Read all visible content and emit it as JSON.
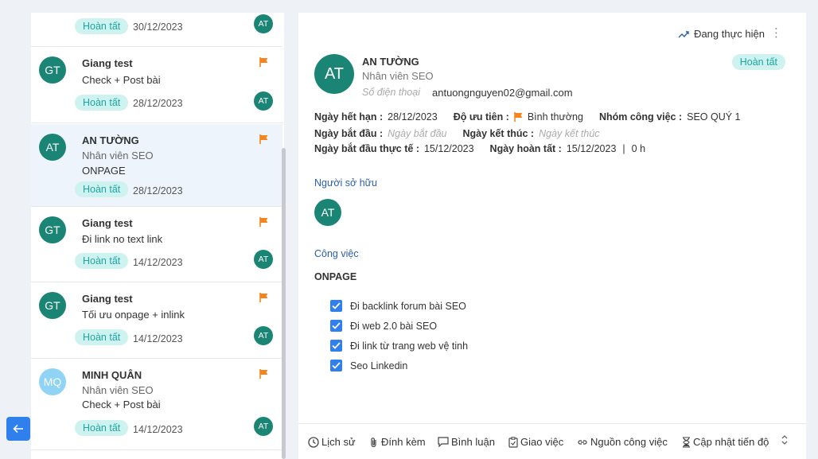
{
  "list": {
    "items": [
      {
        "avatar": "",
        "title": "",
        "lines": [],
        "badge": "Hoàn tất",
        "date": "30/12/2023",
        "assignee": "AT"
      },
      {
        "avatar": "GT",
        "title": "Giang test",
        "lines": [
          "Check + Post bài"
        ],
        "badge": "Hoàn tất",
        "date": "28/12/2023",
        "assignee": "AT"
      },
      {
        "avatar": "AT",
        "title": "AN TƯỜNG",
        "lines": [
          "Nhân viên SEO",
          "ONPAGE"
        ],
        "badge": "Hoàn tất",
        "date": "28/12/2023",
        "assignee": ""
      },
      {
        "avatar": "GT",
        "title": "Giang test",
        "lines": [
          "Đi link no text link"
        ],
        "badge": "Hoàn tất",
        "date": "14/12/2023",
        "assignee": "AT"
      },
      {
        "avatar": "GT",
        "title": "Giang test",
        "lines": [
          "Tối ưu onpage + inlink"
        ],
        "badge": "Hoàn tất",
        "date": "14/12/2023",
        "assignee": "AT"
      },
      {
        "avatar": "MQ",
        "title": "MINH QUÂN",
        "lines": [
          "Nhân viên SEO",
          "Check + Post bài"
        ],
        "badge": "Hoàn tất",
        "date": "14/12/2023",
        "assignee": "AT"
      }
    ]
  },
  "detail": {
    "status_top": "Đang thực hiện",
    "avatar": "AT",
    "name": "AN TƯỜNG",
    "role": "Nhân viên SEO",
    "phone_placeholder": "Số điện thoại",
    "email": "antuongnguyen02@gmail.com",
    "badge": "Hoàn tất",
    "fields": {
      "due_label": "Ngày hết hạn :",
      "due_value": "28/12/2023",
      "priority_label": "Độ ưu tiên :",
      "priority_value": "Bình thường",
      "group_label": "Nhóm công việc :",
      "group_value": "SEO QUÝ 1",
      "start_label": "Ngày bắt đầu :",
      "start_placeholder": "Ngày bắt đầu",
      "end_label": "Ngày kết thúc :",
      "end_placeholder": "Ngày kết thúc",
      "actual_start_label": "Ngày bắt đầu thực tế :",
      "actual_start_value": "15/12/2023",
      "completed_label": "Ngày hoàn tất :",
      "completed_value": "15/12/2023",
      "separator": "|",
      "hours": "0 h"
    },
    "owner_section": "Người sở hữu",
    "owner_avatar": "AT",
    "tasks_section": "Công việc",
    "task_group": "ONPAGE",
    "tasks": [
      "Đi backlink forum bài SEO",
      "Đi web 2.0 bài SEO",
      "Đi link từ trang web vệ tinh",
      "Seo Linkedin"
    ],
    "footer": {
      "history": "Lịch sử",
      "attach": "Đính kèm",
      "comment": "Bình luận",
      "assign": "Giao việc",
      "source": "Nguồn công việc",
      "progress": "Cập nhật tiến độ"
    }
  },
  "colors": {
    "accent": "#2f80ed",
    "avatar": "#1a8574",
    "badge_bg": "#cdf2f0",
    "badge_text": "#1fa5a0",
    "flag": "#f5841f",
    "section": "#2b5fad"
  },
  "icons": [
    "flag-icon",
    "trend-icon",
    "more-vertical-icon",
    "arrow-left-icon",
    "check-icon",
    "clock-icon",
    "paperclip-icon",
    "comment-icon",
    "clipboard-icon",
    "link-icon",
    "hourglass-icon",
    "chevron-updown-icon"
  ]
}
